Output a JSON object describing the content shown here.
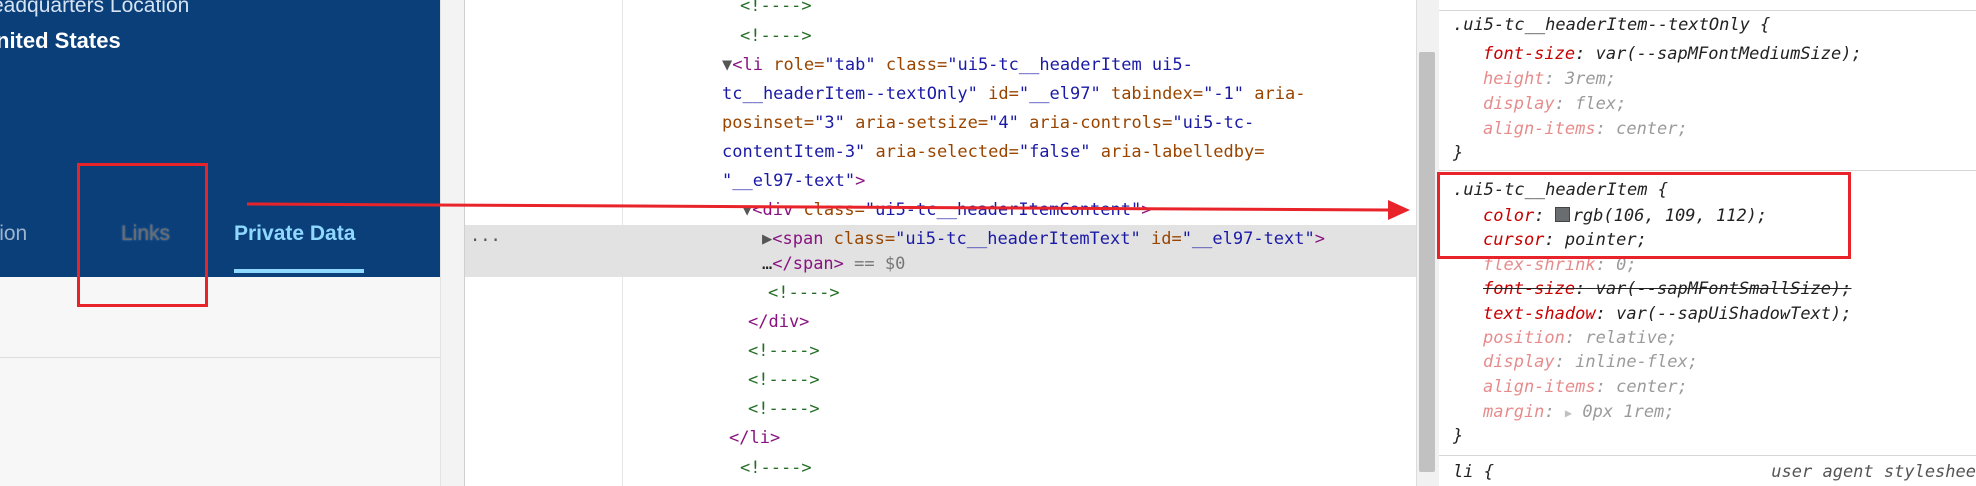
{
  "app": {
    "hq_label": "eadquarters Location",
    "hq_value": "nited States",
    "tabs": [
      {
        "label": "nation",
        "state": "normal"
      },
      {
        "label": "Links",
        "state": "hovered"
      },
      {
        "label": "Private Data",
        "state": "selected"
      }
    ]
  },
  "dom": {
    "ellipsis": "...",
    "lines": [
      {
        "comment": "<!---->"
      },
      {
        "comment": "<!---->"
      },
      {
        "tag_open": "<li",
        "attrs1": " role=",
        "v1": "\"tab\"",
        "attrs2": " class=",
        "v2": "\"ui5-tc__headerItem ui5-"
      },
      {
        "v2b": "tc__headerItem--textOnly\"",
        "a3": " id=",
        "v3": "\"__el97\"",
        "a4": " tabindex=",
        "v4": "\"-1\"",
        "a5": " aria-"
      },
      {
        "a5b": "posinset=",
        "v5": "\"3\"",
        "a6": " aria-setsize=",
        "v6": "\"4\"",
        "a7": " aria-controls=",
        "v7": "\"ui5-tc-"
      },
      {
        "v7b": "contentItem-3\"",
        "a8": " aria-selected=",
        "v8": "\"false\"",
        "a9": " aria-labelledby="
      },
      {
        "v9": "\"__el97-text\"",
        "close": ">"
      },
      {
        "tag": "<div",
        "a": " class=",
        "v": "\"ui5-tc__headerItemContent\"",
        "close": ">"
      },
      {
        "tag": "<span",
        "a1": " class=",
        "v1": "\"ui5-tc__headerItemText\"",
        "a2": " id=",
        "v2": "\"__el97-text\"",
        "close": ">"
      },
      {
        "text": "…",
        "tag": "</span>",
        "eq": " == $0"
      },
      {
        "comment": "<!---->"
      },
      {
        "tag": "</div>"
      },
      {
        "comment": "<!---->"
      },
      {
        "comment": "<!---->"
      },
      {
        "comment": "<!---->"
      },
      {
        "tag": "</li>"
      },
      {
        "comment": "<!---->"
      }
    ]
  },
  "styles": {
    "rule1": {
      "selector": ".ui5-tc__headerItem--textOnly {",
      "props": [
        {
          "name": "font-size",
          "value": "var(--sapMFontMediumSize);"
        },
        {
          "name": "height",
          "value": "3rem;"
        },
        {
          "name": "display",
          "value": "flex;"
        },
        {
          "name": "align-items",
          "value": "center;"
        }
      ],
      "close": "}"
    },
    "rule2": {
      "selector": ".ui5-tc__headerItem {",
      "props": [
        {
          "name": "color",
          "value": "rgb(106, 109, 112);"
        },
        {
          "name": "cursor",
          "value": "pointer;"
        },
        {
          "name": "flex-shrink",
          "value": "0;"
        },
        {
          "name": "font-size",
          "value": "var(--sapMFontSmallSize);"
        },
        {
          "name": "text-shadow",
          "value": "var(--sapUiShadowText);"
        },
        {
          "name": "position",
          "value": "relative;"
        },
        {
          "name": "display",
          "value": "inline-flex;"
        },
        {
          "name": "align-items",
          "value": "center;"
        },
        {
          "name": "margin",
          "value": "0px 1rem;"
        }
      ],
      "close": "}"
    },
    "rule3": {
      "selector": "li {",
      "origin": "user agent styleshee"
    },
    "colon": ":",
    "triangle": "▶"
  },
  "colors": {
    "header_bg": "#0a3f7a",
    "selected_tab": "#8fd8ff",
    "links_color": "#6a6d70",
    "annotation": "#e8242a"
  }
}
